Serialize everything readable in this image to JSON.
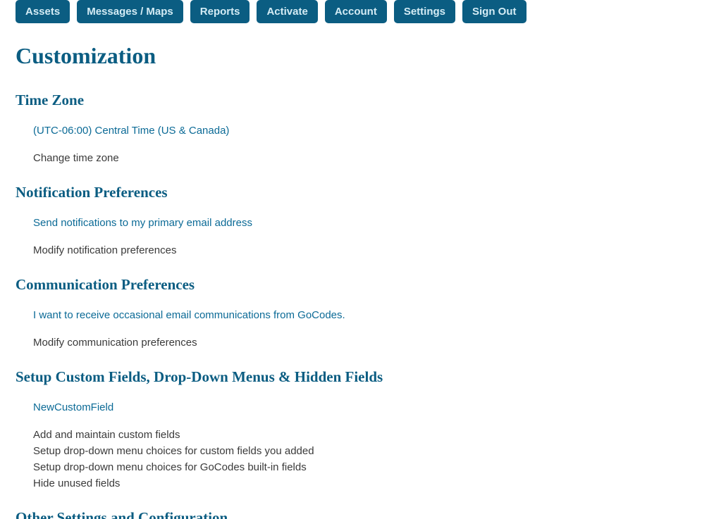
{
  "nav": {
    "assets": "Assets",
    "messages": "Messages / Maps",
    "reports": "Reports",
    "activate": "Activate",
    "account": "Account",
    "settings": "Settings",
    "signout": "Sign Out"
  },
  "page_title": "Customization",
  "sections": {
    "timezone": {
      "title": "Time Zone",
      "value": "(UTC-06:00) Central Time (US & Canada)",
      "action": "Change time zone"
    },
    "notification": {
      "title": "Notification Preferences",
      "value": "Send notifications to my primary email address",
      "action": "Modify notification preferences"
    },
    "communication": {
      "title": "Communication Preferences",
      "value": "I want to receive occasional email communications from GoCodes.",
      "action": "Modify communication preferences"
    },
    "custom_fields": {
      "title": "Setup Custom Fields, Drop-Down Menus & Hidden Fields",
      "value": "NewCustomField",
      "desc1": "Add and maintain custom fields",
      "desc2": "Setup drop-down menu choices for custom fields you added",
      "desc3": "Setup drop-down menu choices for GoCodes built-in fields",
      "desc4": "Hide unused fields"
    },
    "other": {
      "title": "Other Settings and Configuration"
    }
  }
}
